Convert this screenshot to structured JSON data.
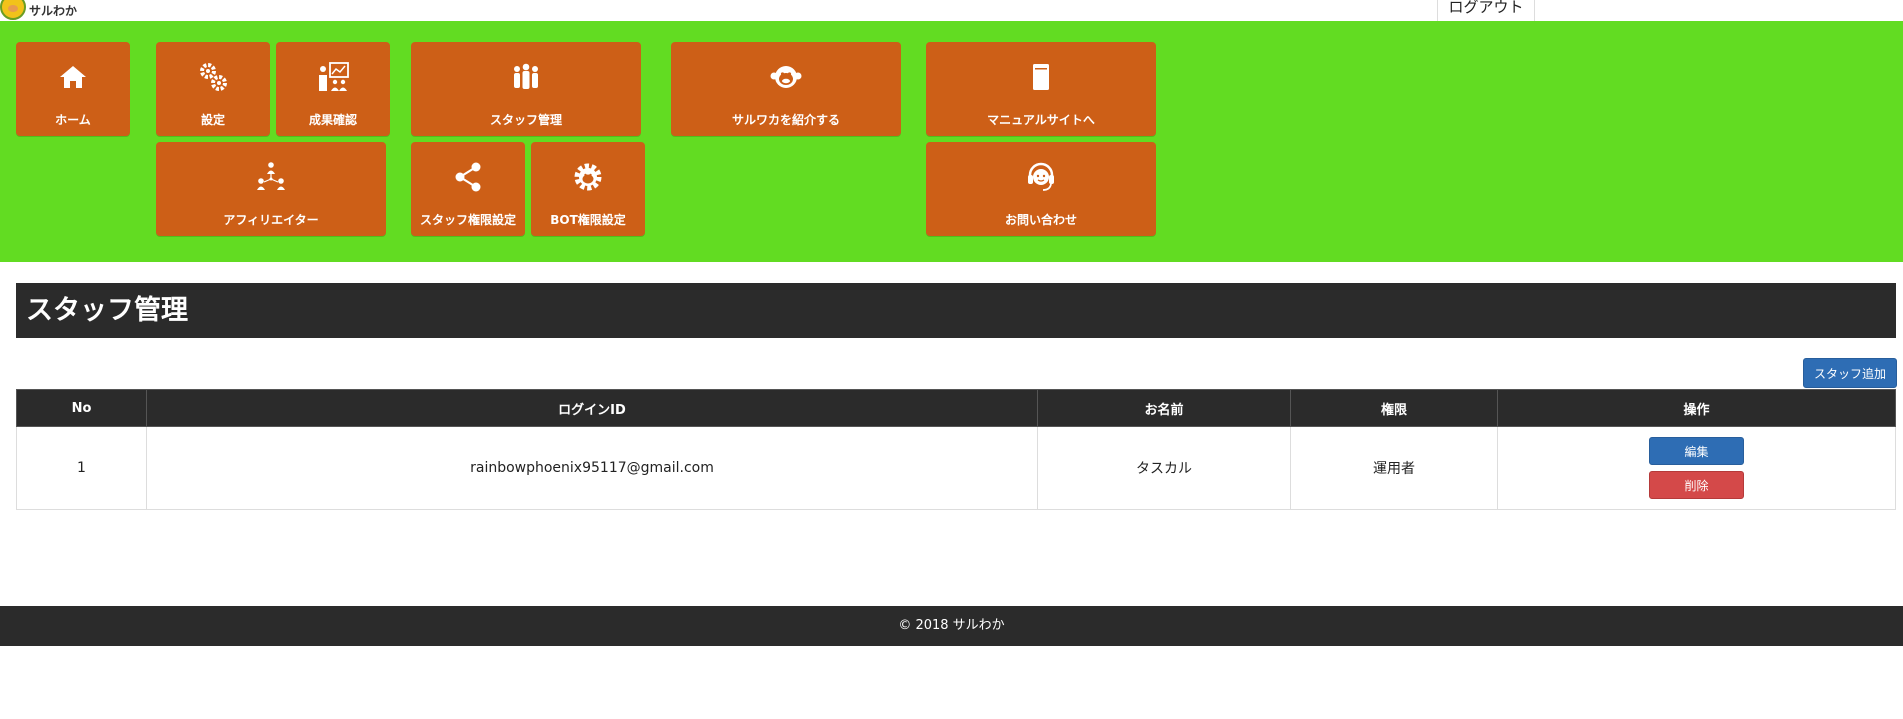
{
  "header": {
    "logo_text": "サルわか",
    "logout_label": "ログアウト"
  },
  "nav": {
    "home": "ホーム",
    "settings": "設定",
    "results": "成果確認",
    "staff": "スタッフ管理",
    "refer": "サルワカを紹介する",
    "manual": "マニュアルサイトへ",
    "affiliate": "アフィリエイター",
    "staff_perm": "スタッフ権限設定",
    "bot_perm": "BOT権限設定",
    "contact": "お問い合わせ"
  },
  "page": {
    "title": "スタッフ管理",
    "add_button": "スタッフ追加"
  },
  "table": {
    "headers": [
      "No",
      "ログインID",
      "お名前",
      "権限",
      "操作"
    ],
    "rows": [
      {
        "no": "1",
        "login_id": "rainbowphoenix95117@gmail.com",
        "name": "タスカル",
        "role": "運用者",
        "edit": "編集",
        "delete": "削除"
      }
    ]
  },
  "footer": {
    "copyright": "© 2018 サルわか"
  },
  "colors": {
    "nav_bg": "#62dc22",
    "tile": "#cd5f17",
    "dark_bar": "#2b2b2b",
    "primary": "#2e6db4",
    "danger": "#d44949"
  }
}
